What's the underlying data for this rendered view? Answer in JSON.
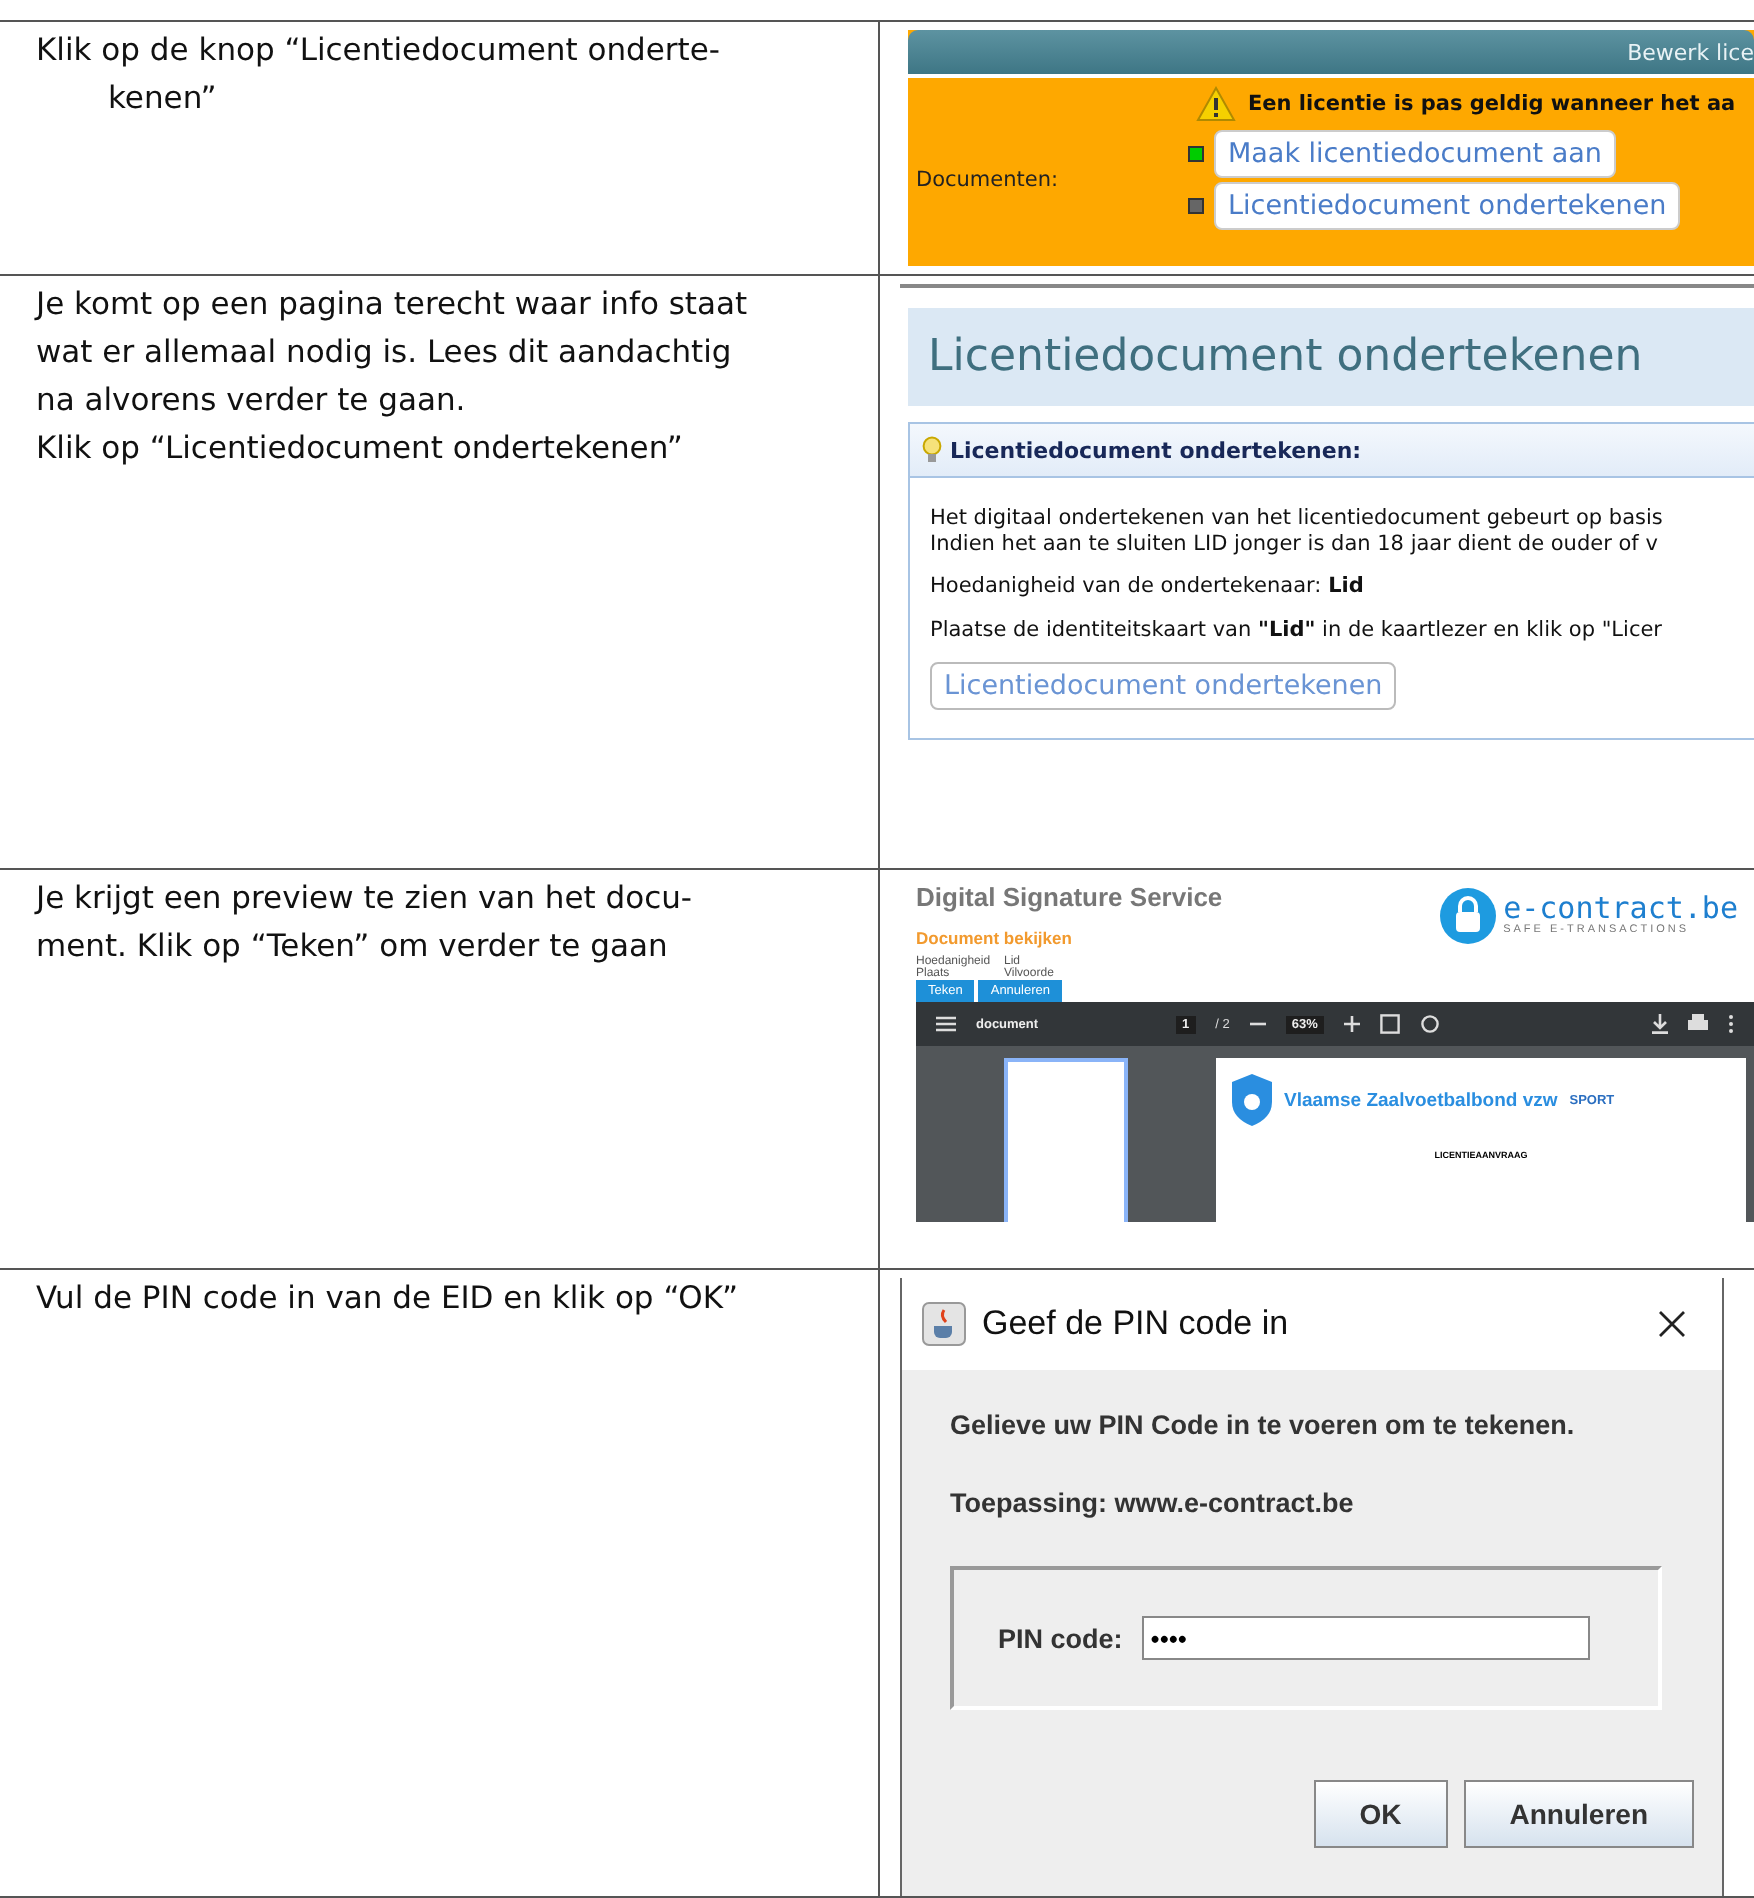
{
  "steps": [
    {
      "paragraphs": [
        "Klik op de knop “Licentiedocument onderte-\nkenen”"
      ],
      "indent": true,
      "screen": {
        "kind": "license-form",
        "header_title": "Bewerk lice",
        "warning": "Een licentie is pas geldig wanneer het aa",
        "documents_label": "Documenten:",
        "buttons": [
          {
            "label": "Maak licentiedocument aan",
            "color": "#00cc00"
          },
          {
            "label": "Licentiedocument ondertekenen",
            "color": "#666666"
          }
        ]
      }
    },
    {
      "paragraphs": [
        "Je komt op een pagina terecht waar info staat\nwat er allemaal nodig is. Lees dit aandachtig\nna alvorens verder te gaan.",
        "Klik op “Licentiedocument ondertekenen”"
      ],
      "screen": {
        "kind": "sign-page",
        "heading": "Licentiedocument ondertekenen",
        "panel_title": "Licentiedocument ondertekenen:",
        "lines": [
          "Het digitaal ondertekenen van het licentiedocument gebeurt op basis",
          "Indien het aan te sluiten LID jonger is dan 18 jaar dient de ouder of v"
        ],
        "paragraphs": [
          "Hoedanigheid van de ondertekenaar: **Lid**",
          "Plaatse de identiteitskaart van **\"Lid\"** in de kaartlezer en klik op \"Licer"
        ],
        "button": "Licentiedocument ondertekenen"
      }
    },
    {
      "paragraphs": [
        "Je krijgt een preview te zien van het docu-\nment. Klik op “Teken” om verder te gaan"
      ],
      "screen": {
        "kind": "preview",
        "title": "Digital Signature Service",
        "subtitle": "Document bekijken",
        "brand": "e-contract.be",
        "tagline": "SAFE E-TRANSACTIONS",
        "fields": [
          {
            "label": "Hoedanigheid",
            "value": "Lid"
          },
          {
            "label": "Plaats",
            "value": "Vilvoorde"
          }
        ],
        "buttons": [
          "Teken",
          "Annuleren"
        ],
        "viewer": {
          "name": "document",
          "page": "1",
          "pages": "/ 2",
          "zoom": "63%"
        },
        "doc_title": "Vlaamse Zaalvoetbalbond vzw",
        "doc_logo": "SPORT",
        "doc_heading": "LICENTIEAANVRAAG"
      }
    },
    {
      "paragraphs": [
        "Vul de PIN code in van de EID en klik op “OK”"
      ],
      "screen": {
        "kind": "pin-dialog",
        "title": "Geef de PIN code in",
        "message": "Gelieve uw PIN Code in te voeren om te tekenen.",
        "application": "Toepassing: www.e-contract.be",
        "field_label": "PIN code:",
        "value": "••••",
        "buttons": [
          "OK",
          "Annuleren"
        ]
      }
    }
  ]
}
